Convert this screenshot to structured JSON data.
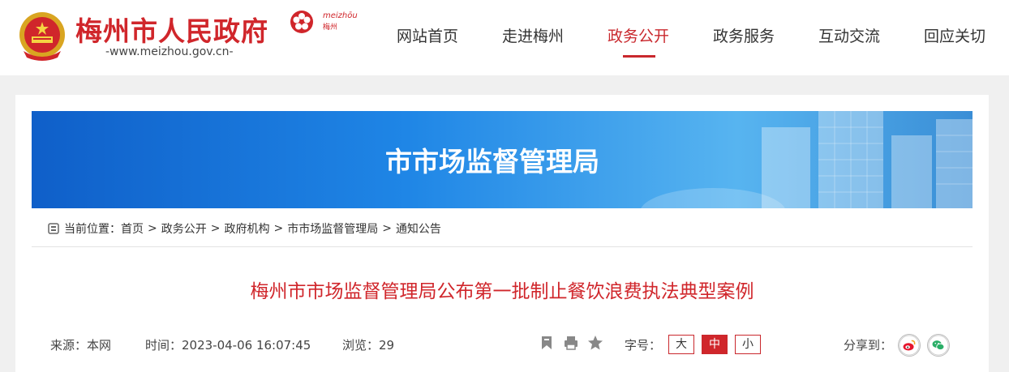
{
  "header": {
    "site_title": "梅州市人民政府",
    "site_url": "-www.meizhou.gov.cn-",
    "city_logo_text_top": "meizhōu",
    "city_logo_text_bottom": "梅州"
  },
  "nav": {
    "items": [
      {
        "label": "网站首页"
      },
      {
        "label": "走进梅州"
      },
      {
        "label": "政务公开",
        "active": true
      },
      {
        "label": "政务服务"
      },
      {
        "label": "互动交流"
      },
      {
        "label": "回应关切"
      }
    ]
  },
  "banner": {
    "title": "市市场监督管理局"
  },
  "breadcrumb": {
    "prefix": "当前位置：",
    "items": [
      "首页",
      "政务公开",
      "政府机构",
      "市市场监督管理局",
      "通知公告"
    ],
    "separator": ">"
  },
  "article": {
    "title": "梅州市市场监督管理局公布第一批制止餐饮浪费执法典型案例",
    "source": "来源：本网",
    "time": "时间：2023-04-06 16:07:45",
    "views": "浏览：29",
    "font_size_label": "字号：",
    "font_sizes": [
      {
        "label": "大"
      },
      {
        "label": "中",
        "active": true
      },
      {
        "label": "小"
      }
    ],
    "share_label": "分享到："
  },
  "colors": {
    "brand_red": "#d0262b",
    "banner_blue": "#1f86e6",
    "weibo": "#e6162d",
    "wechat": "#2aae67"
  },
  "icons": [
    "national-emblem-icon",
    "plum-blossom-logo-icon",
    "home-icon",
    "bookmark-icon",
    "print-icon",
    "star-icon",
    "weibo-icon",
    "wechat-icon"
  ]
}
